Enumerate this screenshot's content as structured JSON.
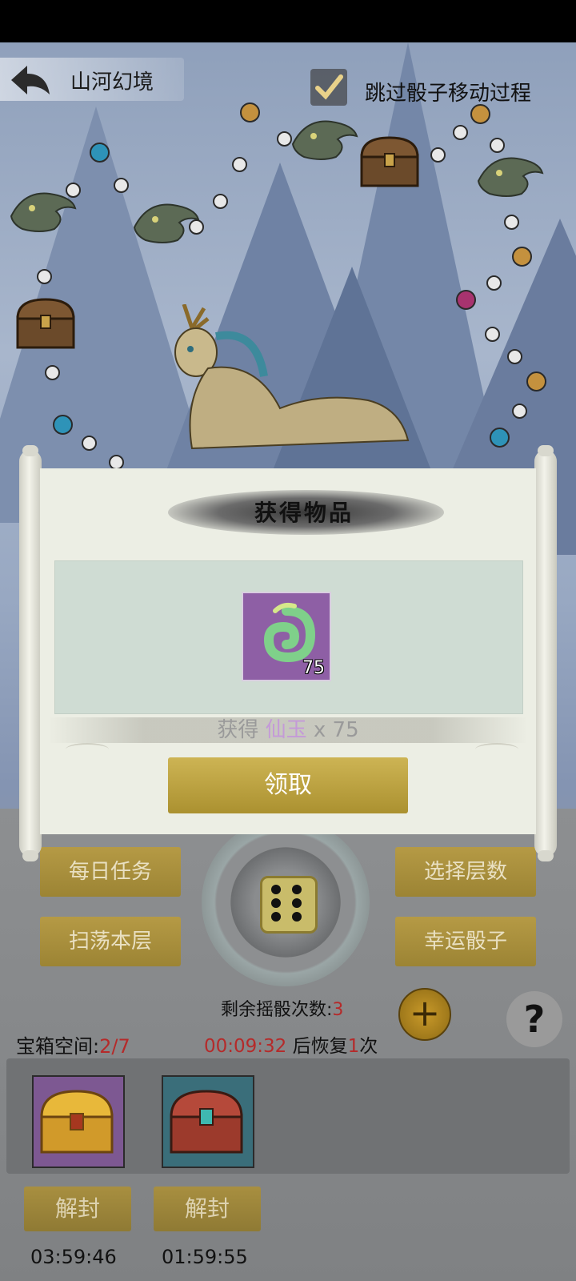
{
  "header": {
    "title": "山河幻境",
    "skip_checkbox_checked": true,
    "skip_label": "跳过骰子移动过程"
  },
  "controls": {
    "daily_tasks": "每日任务",
    "select_floor": "选择层数",
    "sweep_floor": "扫荡本层",
    "lucky_dice": "幸运骰子",
    "rolls_label": "剩余摇骰次数:",
    "rolls_count": "3",
    "help_icon": "?",
    "add_icon": "+"
  },
  "chest_space": {
    "label": "宝箱空间:",
    "value": "2/7"
  },
  "recovery": {
    "timer": "00:09:32",
    "text_before": "后恢复",
    "count": "1",
    "text_after": "次"
  },
  "chests": [
    {
      "type": "gold-chest-icon",
      "button": "解封",
      "countdown": "03:59:46"
    },
    {
      "type": "red-chest-icon",
      "button": "解封",
      "countdown": "01:59:55"
    }
  ],
  "modal": {
    "title": "获得物品",
    "item": {
      "name": "仙玉",
      "icon": "jade-icon",
      "count": "75"
    },
    "obtain_prefix": "获得",
    "obtain_item": "仙玉",
    "obtain_suffix": "x 75",
    "claim_button": "领取"
  },
  "colors": {
    "accent_gold": "#b59a45",
    "highlight_red": "#b52a2a",
    "item_purple": "#8e5fa5"
  }
}
